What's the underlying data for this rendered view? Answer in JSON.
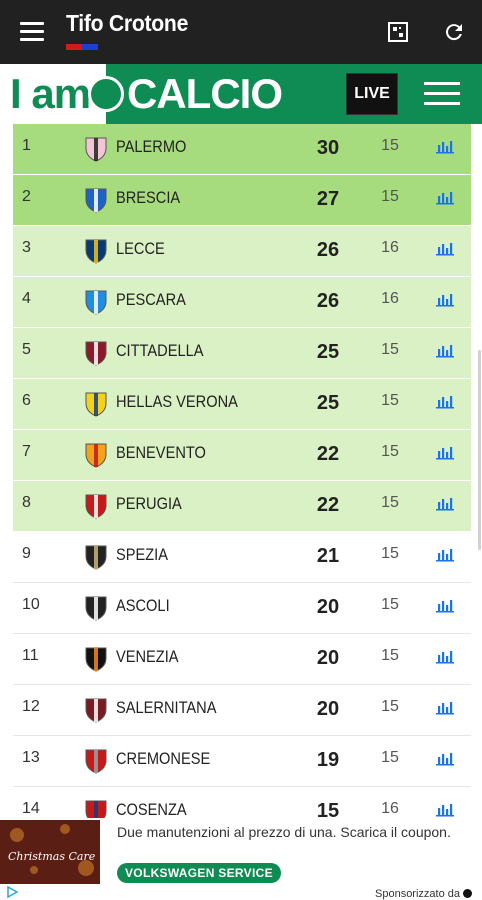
{
  "app": {
    "title": "Tifo Crotone",
    "flag_colors": [
      "#d11a1a",
      "#1a3fd1"
    ]
  },
  "banner": {
    "logo_part1": "I am",
    "logo_part2": "CALCIO",
    "live_label": "LIVE",
    "brand_color": "#0f8c54"
  },
  "standings": {
    "rows": [
      {
        "pos": "1",
        "team": "PALERMO",
        "pts": "30",
        "gp": "15",
        "zone": "promo",
        "crest": "palermo-crest",
        "colors": [
          "#f2c6d4",
          "#222222"
        ]
      },
      {
        "pos": "2",
        "team": "BRESCIA",
        "pts": "27",
        "gp": "15",
        "zone": "promo",
        "crest": "brescia-crest",
        "colors": [
          "#1e63c4",
          "#ffffff"
        ]
      },
      {
        "pos": "3",
        "team": "LECCE",
        "pts": "26",
        "gp": "16",
        "zone": "playoff",
        "crest": "lecce-crest",
        "colors": [
          "#0b3b6e",
          "#f4c21b"
        ]
      },
      {
        "pos": "4",
        "team": "PESCARA",
        "pts": "26",
        "gp": "16",
        "zone": "playoff",
        "crest": "pescara-crest",
        "colors": [
          "#1f8ee0",
          "#ffffff"
        ]
      },
      {
        "pos": "5",
        "team": "CITTADELLA",
        "pts": "25",
        "gp": "15",
        "zone": "playoff",
        "crest": "cittadella-crest",
        "colors": [
          "#8b1a2b",
          "#ffffff"
        ]
      },
      {
        "pos": "6",
        "team": "HELLAS VERONA",
        "pts": "25",
        "gp": "15",
        "zone": "playoff",
        "crest": "hellas-verona-crest",
        "colors": [
          "#f2d21b",
          "#1b3b7a"
        ]
      },
      {
        "pos": "7",
        "team": "BENEVENTO",
        "pts": "22",
        "gp": "15",
        "zone": "playoff",
        "crest": "benevento-crest",
        "colors": [
          "#f2a21b",
          "#c41a1a"
        ]
      },
      {
        "pos": "8",
        "team": "PERUGIA",
        "pts": "22",
        "gp": "15",
        "zone": "playoff",
        "crest": "perugia-crest",
        "colors": [
          "#c41a1a",
          "#ffffff"
        ]
      },
      {
        "pos": "9",
        "team": "SPEZIA",
        "pts": "21",
        "gp": "15",
        "zone": "normal",
        "crest": "spezia-crest",
        "colors": [
          "#222222",
          "#c9b47a"
        ]
      },
      {
        "pos": "10",
        "team": "ASCOLI",
        "pts": "20",
        "gp": "15",
        "zone": "normal",
        "crest": "ascoli-crest",
        "colors": [
          "#222222",
          "#ffffff"
        ]
      },
      {
        "pos": "11",
        "team": "VENEZIA",
        "pts": "20",
        "gp": "15",
        "zone": "normal",
        "crest": "venezia-crest",
        "colors": [
          "#111111",
          "#f28a1b"
        ]
      },
      {
        "pos": "12",
        "team": "SALERNITANA",
        "pts": "20",
        "gp": "15",
        "zone": "normal",
        "crest": "salernitana-crest",
        "colors": [
          "#7a1a22",
          "#ffffff"
        ]
      },
      {
        "pos": "13",
        "team": "CREMONESE",
        "pts": "19",
        "gp": "15",
        "zone": "normal",
        "crest": "cremonese-crest",
        "colors": [
          "#c41a1a",
          "#9aa0a6"
        ]
      },
      {
        "pos": "14",
        "team": "COSENZA",
        "pts": "15",
        "gp": "16",
        "zone": "normal",
        "crest": "cosenza-crest",
        "colors": [
          "#c41a1a",
          "#1b3b7a"
        ]
      }
    ]
  },
  "ad": {
    "image_text": "Christmas Care",
    "text": "Due manutenzioni al prezzo di una. Scarica il coupon.",
    "cta": "VOLKSWAGEN SERVICE",
    "sponsor_label": "Sponsorizzato da"
  }
}
